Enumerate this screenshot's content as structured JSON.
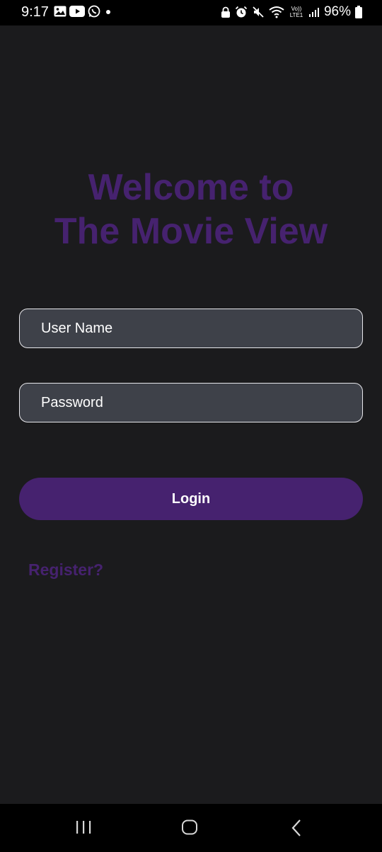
{
  "status_bar": {
    "time": "9:17",
    "left_icons": [
      "gallery-icon",
      "youtube-icon",
      "whatsapp-icon",
      "dot-icon"
    ],
    "right_icons": [
      "lock-icon",
      "alarm-icon",
      "mute-icon",
      "wifi-icon",
      "volte-icon",
      "signal-icon",
      "battery-icon"
    ],
    "volte_label": "Vo)) LTE1",
    "battery": "96%"
  },
  "welcome": {
    "line1": "Welcome to",
    "line2": "The Movie View",
    "color": "#46226f"
  },
  "form": {
    "username_placeholder": "User Name",
    "password_placeholder": "Password",
    "login_label": "Login",
    "register_label": "Register?"
  },
  "colors": {
    "background": "#1b1b1d",
    "field_background": "#3e4149",
    "accent": "#46226f"
  },
  "nav_bar": {
    "buttons": [
      "recents-icon",
      "home-icon",
      "back-icon"
    ]
  }
}
